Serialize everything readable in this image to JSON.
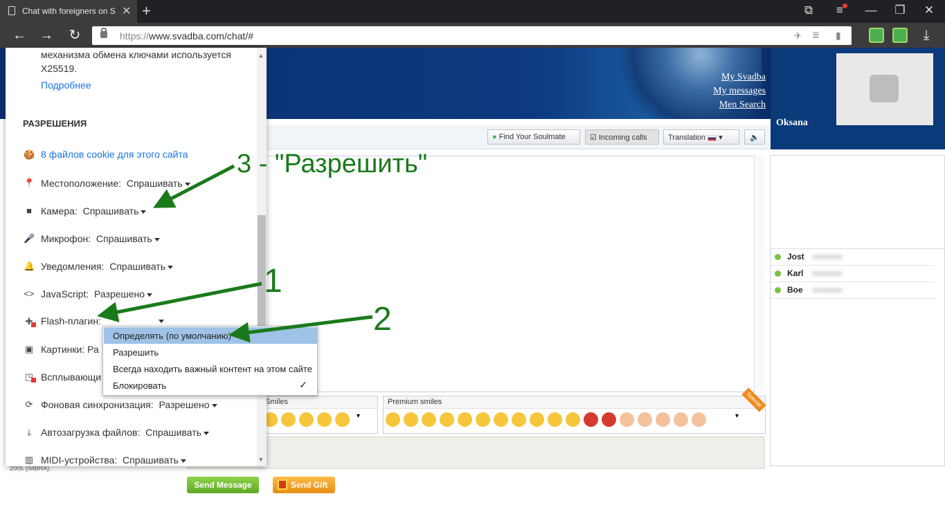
{
  "browser": {
    "tab_title": "Chat with foreigners on S",
    "url_scheme": "https://",
    "url_host": "www.svadba.com/chat/#"
  },
  "site": {
    "links": [
      "My Svadba",
      "My messages",
      "Men Search"
    ],
    "profile_name": "Oksana",
    "toolbar": {
      "soulmate": "Find Your Soulmate",
      "incoming": "Incoming calls",
      "translation": "Translation"
    },
    "contacts": [
      "Jost",
      "Karl",
      "Boe"
    ],
    "smiles_label": "Smiles",
    "premium_label": "Premium smiles",
    "special_label": "Special",
    "send_message": "Send Message",
    "send_gift": "Send Gift",
    "copyright": "2005 (IMBRA)."
  },
  "popup": {
    "key_text_1": "механизма обмена ключами используется",
    "key_text_2": "X25519.",
    "more_link": "Подробнее",
    "permissions_heading": "РАЗРЕШЕНИЯ",
    "cookies": "8 файлов cookie для этого сайта",
    "rows": [
      {
        "label": "Местоположение:",
        "value": "Спрашивать"
      },
      {
        "label": "Камера:",
        "value": "Спрашивать"
      },
      {
        "label": "Микрофон:",
        "value": "Спрашивать"
      },
      {
        "label": "Уведомления:",
        "value": "Спрашивать"
      },
      {
        "label": "JavaScript:",
        "value": "Разрешено"
      },
      {
        "label": "Flash-плагин:",
        "value": ""
      },
      {
        "label": "Картинки:",
        "value": "Ра"
      },
      {
        "label": "Всплывающи",
        "value": ""
      },
      {
        "label": "Фоновая синхронизация:",
        "value": "Разрешено"
      },
      {
        "label": "Автозагрузка файлов:",
        "value": "Спрашивать"
      },
      {
        "label": "MIDI-устройства:",
        "value": "Спрашивать"
      }
    ]
  },
  "flash_menu": {
    "options": [
      "Определять (по умолчанию)",
      "Разрешить",
      "Всегда находить важный контент на этом сайте",
      "Блокировать"
    ],
    "selected_check": "✓"
  },
  "annotations": {
    "step1": "1",
    "step2": "2",
    "step3": "3 - \"Разрешить\"",
    "color": "#1a7a1a"
  }
}
